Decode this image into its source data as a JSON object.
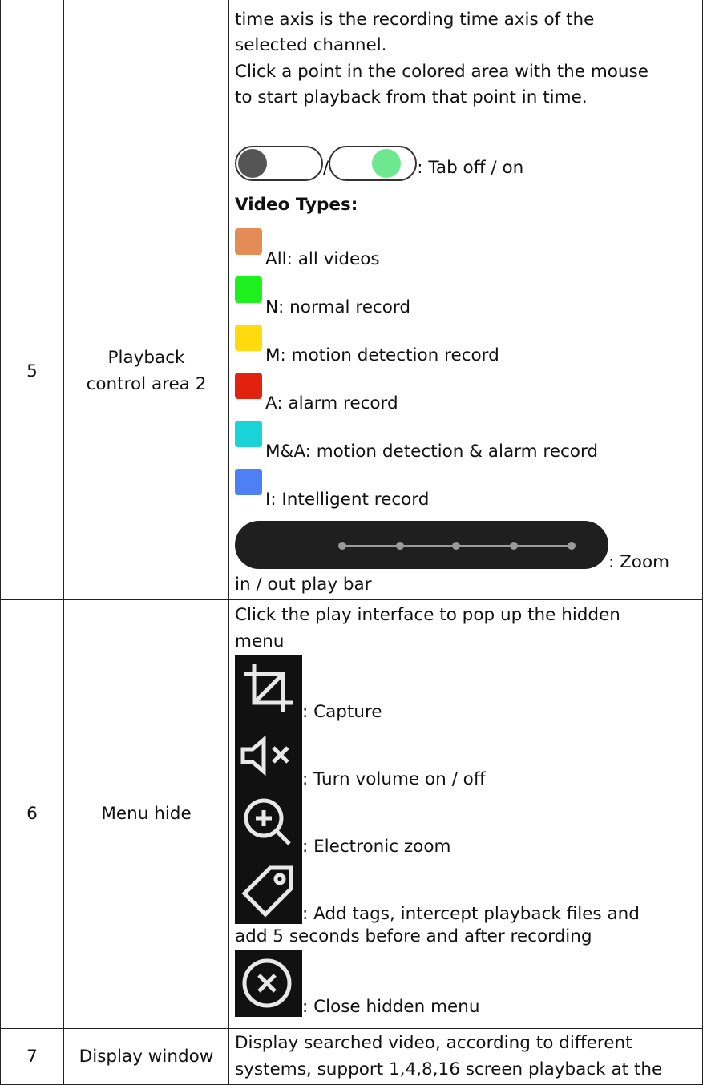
{
  "rows": [
    {
      "num": "",
      "name": "",
      "lines": [
        "time axis is the recording time axis of the",
        "selected channel.",
        "Click a point in the colored area with the mouse",
        "to start playback from that point in time."
      ]
    },
    {
      "num": "5",
      "name": "Playback control area 2",
      "toggle_separator": "/",
      "toggle_caption": ": Tab off / on",
      "video_types_heading": "Video Types:",
      "video_types": [
        {
          "color": "#e38c55",
          "label": "All: all videos"
        },
        {
          "color": "#1ef01e",
          "label": "N: normal record"
        },
        {
          "color": "#ffdb0d",
          "label": "M: motion detection record"
        },
        {
          "color": "#e0220f",
          "label": "A: alarm record"
        },
        {
          "color": "#1ad3d8",
          "label": "M&A: motion detection & alarm record"
        },
        {
          "color": "#4d7ff5",
          "label": "I: Intelligent record"
        }
      ],
      "zoom_caption_a": ": Zoom",
      "zoom_caption_b": "in / out play bar"
    },
    {
      "num": "6",
      "name": "Menu hide",
      "intro_a": "Click the play interface to pop up the hidden",
      "intro_b": "menu",
      "icons": [
        {
          "icon": "crop-icon",
          "caption": ": Capture"
        },
        {
          "icon": "volume-mute-icon",
          "caption": ": Turn volume on / off"
        },
        {
          "icon": "zoom-in-icon",
          "caption": ": Electronic zoom"
        },
        {
          "icon": "tag-icon",
          "caption": ": Add tags, intercept playback files and",
          "caption2": "add 5 seconds before and after recording"
        },
        {
          "icon": "close-circle-icon",
          "caption": ": Close hidden menu"
        }
      ]
    },
    {
      "num": "7",
      "name": "Display window",
      "lines": [
        "Display searched video, according to different",
        "systems, support 1,4,8,16 screen playback at the"
      ]
    }
  ]
}
